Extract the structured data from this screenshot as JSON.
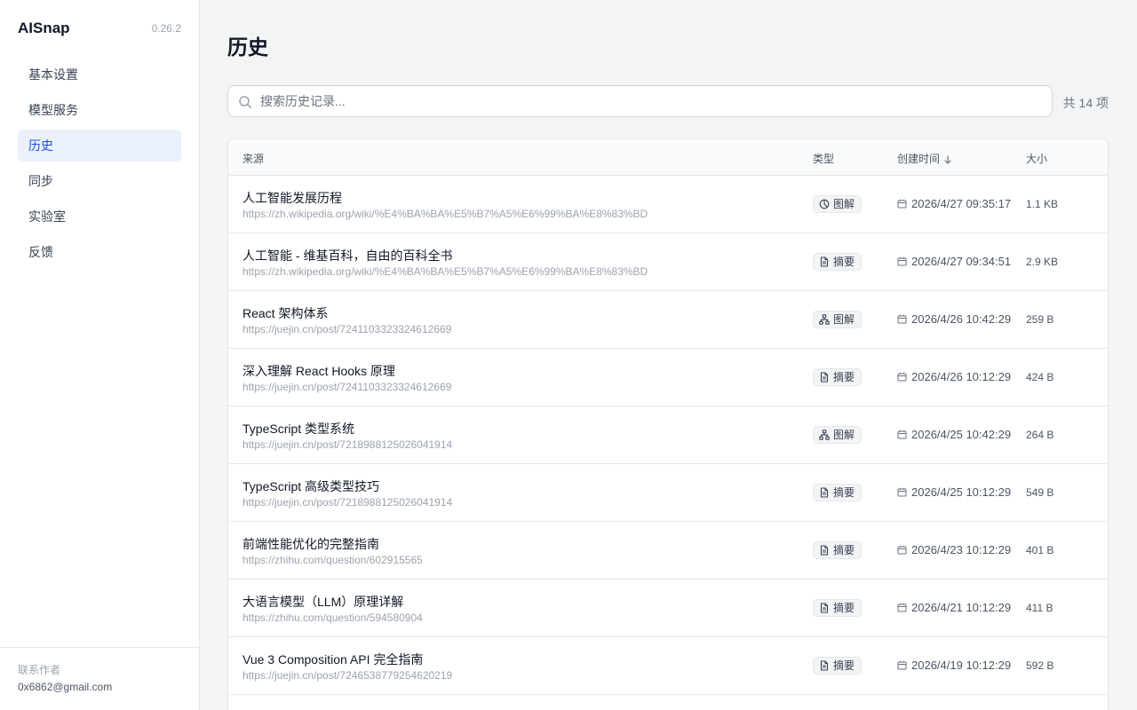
{
  "app": {
    "name": "AISnap",
    "version": "0.26.2"
  },
  "sidebar": {
    "items": [
      {
        "label": "基本设置",
        "active": false
      },
      {
        "label": "模型服务",
        "active": false
      },
      {
        "label": "历史",
        "active": true
      },
      {
        "label": "同步",
        "active": false
      },
      {
        "label": "实验室",
        "active": false
      },
      {
        "label": "反馈",
        "active": false
      }
    ],
    "footer": {
      "label": "联系作者",
      "email": "0x6862@gmail.com"
    }
  },
  "main": {
    "title": "历史",
    "search": {
      "placeholder": "搜索历史记录...",
      "value": ""
    },
    "total": "共 14 项",
    "table": {
      "columns": {
        "source": "来源",
        "type": "类型",
        "created": "创建时间",
        "size": "大小"
      },
      "sort_icon": "arrow-down-icon",
      "rows": [
        {
          "title": "人工智能发展历程",
          "url": "https://zh.wikipedia.org/wiki/%E4%BA%BA%E5%B7%A5%E6%99%BA%E8%83%BD",
          "type": "图解",
          "type_icon": "pie-chart-icon",
          "created": "2026/4/27 09:35:17",
          "size": "1.1 KB"
        },
        {
          "title": "人工智能 - 维基百科，自由的百科全书",
          "url": "https://zh.wikipedia.org/wiki/%E4%BA%BA%E5%B7%A5%E6%99%BA%E8%83%BD",
          "type": "摘要",
          "type_icon": "document-icon",
          "created": "2026/4/27 09:34:51",
          "size": "2.9 KB"
        },
        {
          "title": "React 架构体系",
          "url": "https://juejin.cn/post/7241103323324612669",
          "type": "图解",
          "type_icon": "hierarchy-icon",
          "created": "2026/4/26 10:42:29",
          "size": "259 B"
        },
        {
          "title": "深入理解 React Hooks 原理",
          "url": "https://juejin.cn/post/7241103323324612669",
          "type": "摘要",
          "type_icon": "document-icon",
          "created": "2026/4/26 10:12:29",
          "size": "424 B"
        },
        {
          "title": "TypeScript 类型系统",
          "url": "https://juejin.cn/post/7218988125026041914",
          "type": "图解",
          "type_icon": "hierarchy-icon",
          "created": "2026/4/25 10:42:29",
          "size": "264 B"
        },
        {
          "title": "TypeScript 高级类型技巧",
          "url": "https://juejin.cn/post/7218988125026041914",
          "type": "摘要",
          "type_icon": "document-icon",
          "created": "2026/4/25 10:12:29",
          "size": "549 B"
        },
        {
          "title": "前端性能优化的完整指南",
          "url": "https://zhihu.com/question/602915565",
          "type": "摘要",
          "type_icon": "document-icon",
          "created": "2026/4/23 10:12:29",
          "size": "401 B"
        },
        {
          "title": "大语言模型（LLM）原理详解",
          "url": "https://zhihu.com/question/594580904",
          "type": "摘要",
          "type_icon": "document-icon",
          "created": "2026/4/21 10:12:29",
          "size": "411 B"
        },
        {
          "title": "Vue 3 Composition API 完全指南",
          "url": "https://juejin.cn/post/7246538779254620219",
          "type": "摘要",
          "type_icon": "document-icon",
          "created": "2026/4/19 10:12:29",
          "size": "592 B"
        }
      ]
    }
  },
  "colors": {
    "accent": "#1d4ed8",
    "active_bg": "#eaf1fd",
    "page_bg": "#f3f4f6"
  }
}
